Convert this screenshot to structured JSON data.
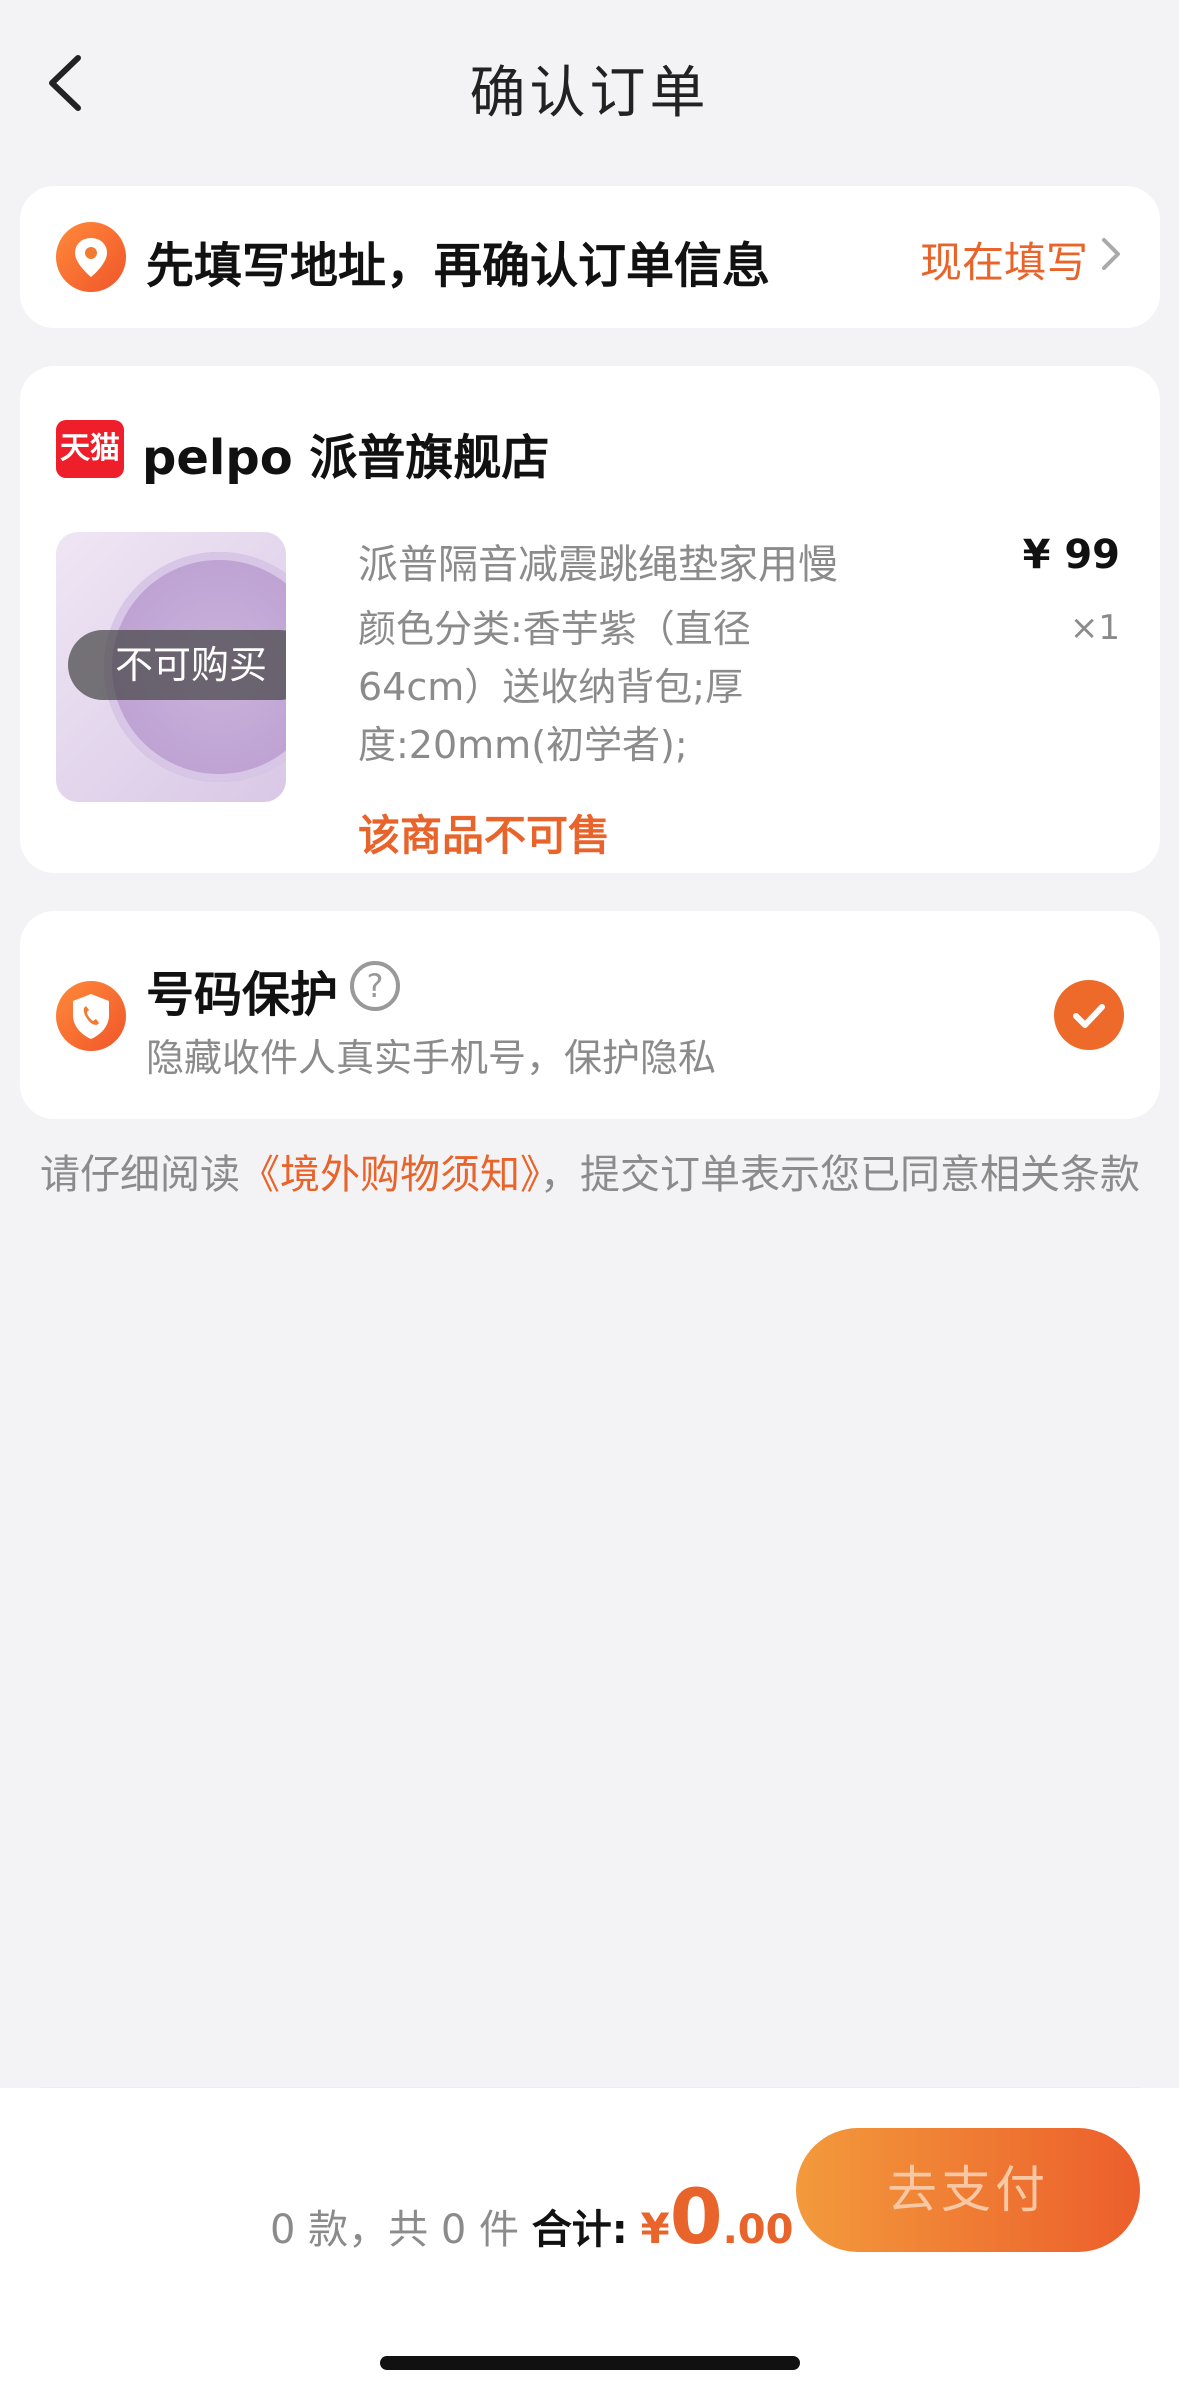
{
  "header": {
    "title": "确认订单",
    "back_icon": "chevron-left-icon"
  },
  "address": {
    "prompt": "先填写地址，再确认订单信息",
    "action": "现在填写",
    "pin_icon": "location-pin-icon"
  },
  "shop": {
    "badge": "天猫",
    "name": "pelpo 派普旗舰店",
    "product": {
      "title": "派普隔音减震跳绳垫家用慢",
      "spec": "颜色分类:香芋紫（直径 64cm）送收纳背包;厚度:20mm(初学者);",
      "price": "¥ 99",
      "qty": "×1",
      "overlay": "不可购买",
      "status": "该商品不可售"
    }
  },
  "protection": {
    "title": "号码保护",
    "subtitle": "隐藏收件人真实手机号，保护隐私",
    "checked": true
  },
  "notice": {
    "prefix": "请仔细阅读",
    "link": "《境外购物须知》",
    "suffix": "，提交订单表示您已同意相关条款"
  },
  "footer": {
    "count_text": "0 款，共 0 件",
    "total_label": "合计:",
    "currency": "¥",
    "amount_int": "0",
    "amount_dec": ".00",
    "pay_label": "去支付"
  },
  "colors": {
    "accent": "#e8642b",
    "tmall": "#ee1f2a",
    "background": "#f3f3f5"
  }
}
